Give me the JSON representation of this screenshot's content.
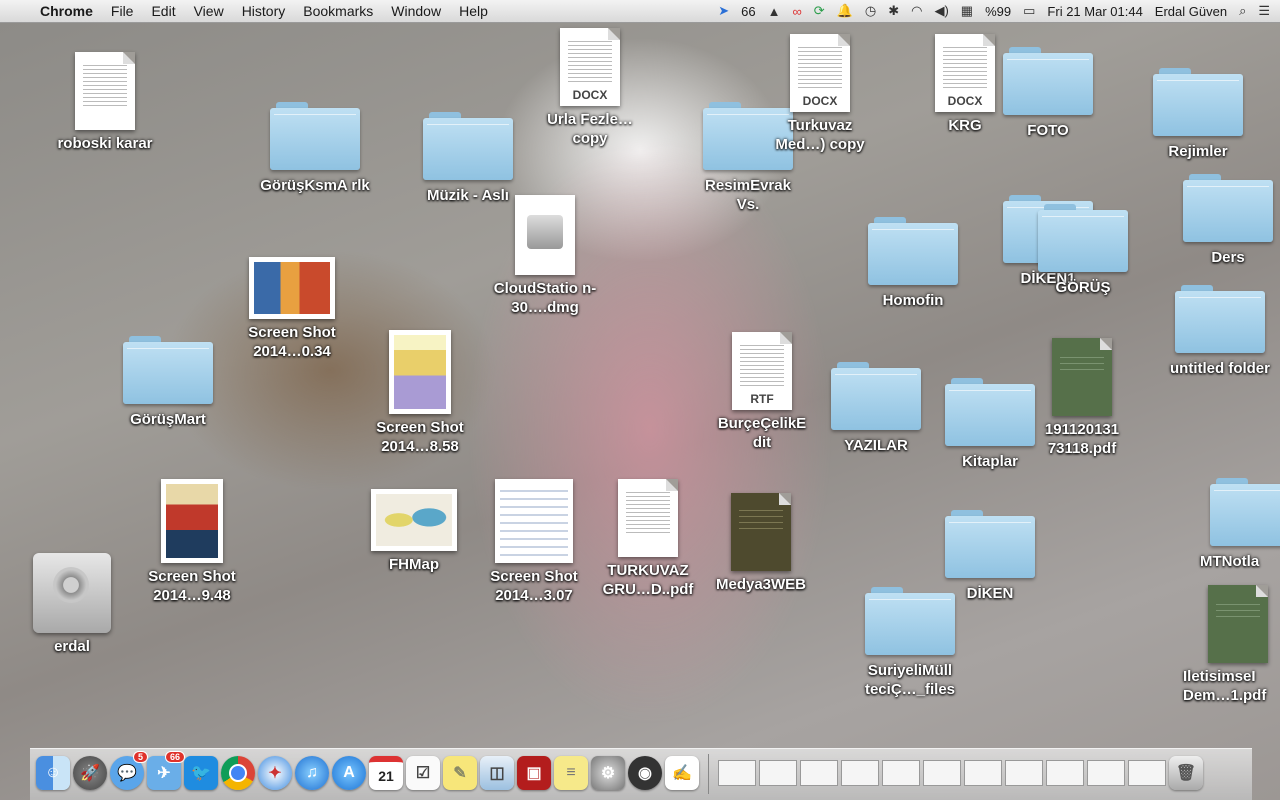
{
  "menubar": {
    "app": "Chrome",
    "menus": [
      "File",
      "Edit",
      "View",
      "History",
      "Bookmarks",
      "Window",
      "Help"
    ],
    "right": {
      "notif_count": "66",
      "battery": "%99",
      "datetime": "Fri 21 Mar  01:44",
      "user": "Erdal Güven"
    }
  },
  "desktop": {
    "roboski": "roboski karar",
    "goruskm": "GörüşKsmA rlk",
    "muzik": "Müzik - Aslı",
    "urla": "Urla Fezle…copy",
    "resimevrak": "ResimEvrak Vs.",
    "turkuvazmed": "Turkuvaz Med…) copy",
    "krg": "KRG",
    "foto": "FOTO",
    "rejimler": "Rejimler",
    "ders": "Ders",
    "cloudstation": "CloudStatio n-30….dmg",
    "screenshot1": "Screen Shot 2014…0.34",
    "diken1": "DİKEN1",
    "gorus": "GÖRÜŞ",
    "homofin": "Homofin",
    "untitled": "untitled folder",
    "gorusmart": "GörüşMart",
    "screenshot2": "Screen Shot 2014…8.58",
    "burce": "BurçeÇelikE dit",
    "yazilar": "YAZILAR",
    "kitaplar": "Kitaplar",
    "pdf1911": "191120131 73118.pdf",
    "screenshot3": "Screen Shot 2014…9.48",
    "fhmap": "FHMap",
    "screenshot4": "Screen Shot 2014…3.07",
    "turkuvazgru": "TURKUVAZ GRU…D..pdf",
    "medya3": "Medya3WEB",
    "diken": "DİKEN",
    "mtnotla": "MTNotla",
    "erdal": "erdal",
    "suriyeli": "SuriyeliMüll teciÇ…_files",
    "iletisim": "IletisimseI Dem…1.pdf"
  },
  "doc_ext": {
    "docx": "DOCX",
    "rtf": "RTF"
  },
  "dock": {
    "messages_badge": "5",
    "mail_badge": "66",
    "calendar_day": "21"
  },
  "colors": {
    "folder": "#8fc2e1",
    "menubar": "#e6e6e6",
    "label": "#ffffff"
  }
}
